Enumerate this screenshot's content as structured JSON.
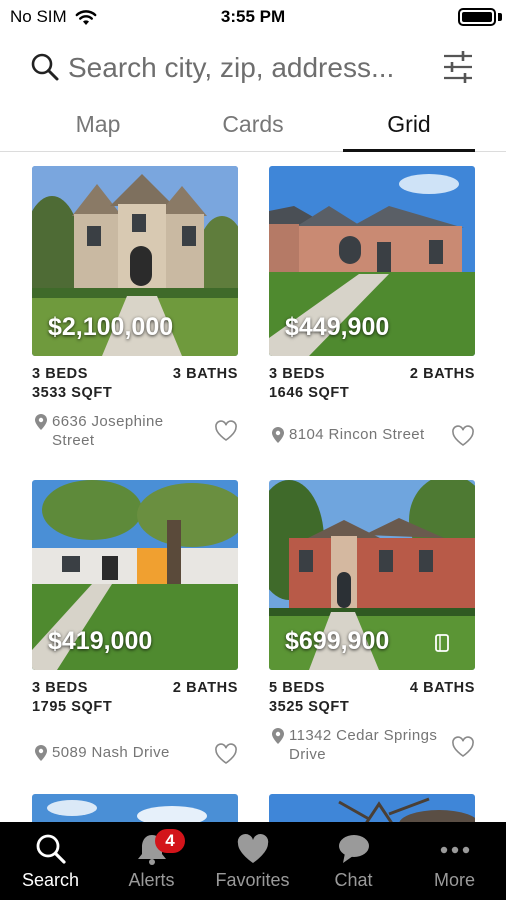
{
  "status_bar": {
    "carrier": "No SIM",
    "time": "3:55 PM"
  },
  "search": {
    "placeholder": "Search city, zip, address..."
  },
  "tabs": [
    {
      "label": "Map",
      "active": false
    },
    {
      "label": "Cards",
      "active": false
    },
    {
      "label": "Grid",
      "active": true
    }
  ],
  "listings": [
    {
      "price": "$2,100,000",
      "beds": "3 BEDS",
      "baths": "3 BATHS",
      "sqft": "3533 SQFT",
      "address": "6636 Josephine Street"
    },
    {
      "price": "$449,900",
      "beds": "3 BEDS",
      "baths": "2 BATHS",
      "sqft": "1646 SQFT",
      "address": "8104 Rincon Street"
    },
    {
      "price": "$419,000",
      "beds": "3 BEDS",
      "baths": "2 BATHS",
      "sqft": "1795 SQFT",
      "address": "5089 Nash Drive"
    },
    {
      "price": "$699,900",
      "beds": "5 BEDS",
      "baths": "4 BATHS",
      "sqft": "3525 SQFT",
      "address": "11342 Cedar Springs Drive"
    }
  ],
  "bottom_nav": {
    "items": [
      {
        "label": "Search",
        "icon": "search-icon",
        "active": true
      },
      {
        "label": "Alerts",
        "icon": "bell-icon",
        "badge": "4"
      },
      {
        "label": "Favorites",
        "icon": "heart-icon"
      },
      {
        "label": "Chat",
        "icon": "chat-bubble-icon"
      },
      {
        "label": "More",
        "icon": "more-dots-icon"
      }
    ]
  },
  "colors": {
    "badge": "#d3141a",
    "nav_background": "#000000",
    "accent_text": "#111111"
  }
}
